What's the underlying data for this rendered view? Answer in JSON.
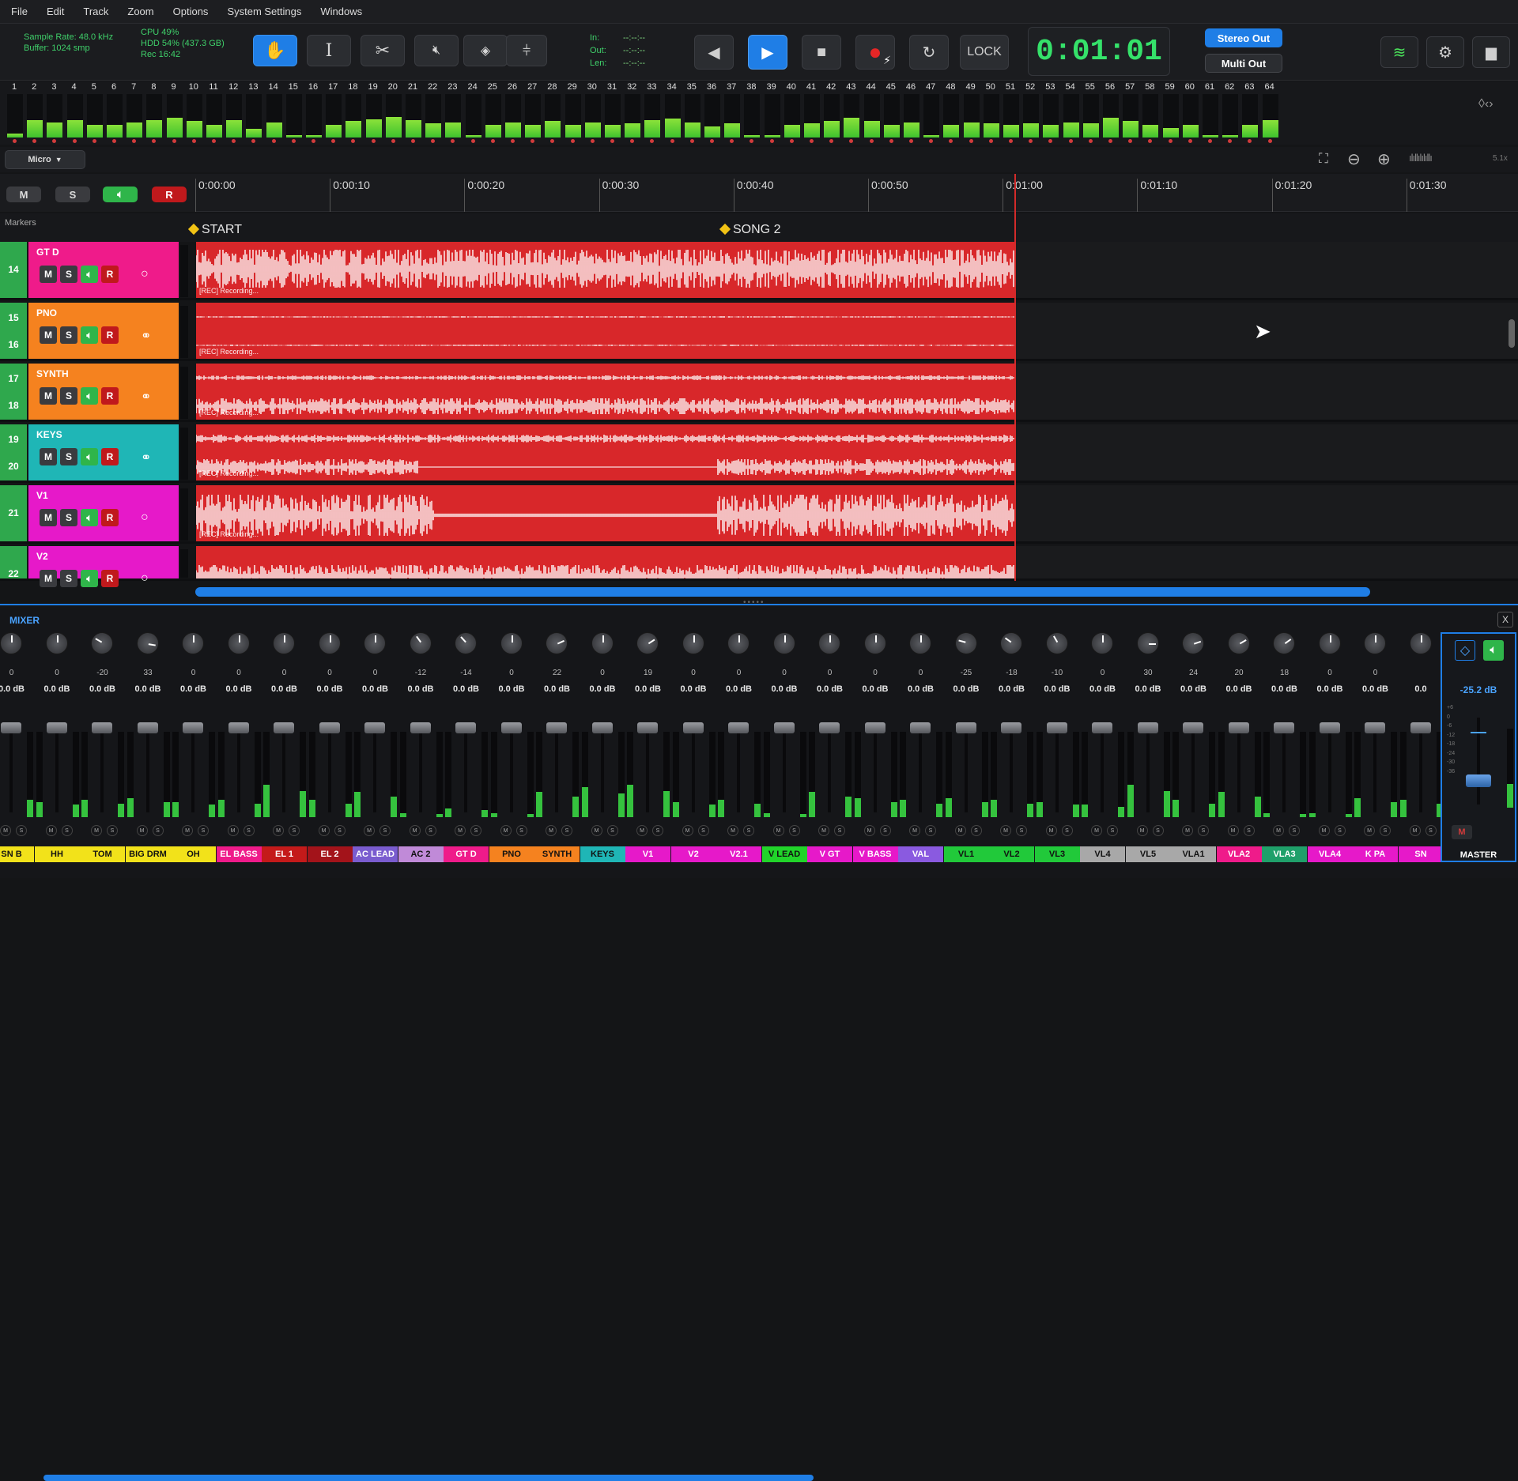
{
  "menu": [
    "File",
    "Edit",
    "Track",
    "Zoom",
    "Options",
    "System Settings",
    "Windows"
  ],
  "status": {
    "sample_rate": "Sample Rate: 48.0 kHz",
    "buffer": "Buffer: 1024 smp",
    "cpu": "CPU 49%",
    "hdd": "HDD 54% (437.3 GB)",
    "rec": "Rec 16:42"
  },
  "io": {
    "in": "In:",
    "out": "Out:",
    "len": "Len:",
    "in_val": "--:--:--",
    "out_val": "--:--:--",
    "len_val": "--:--:--"
  },
  "transport": {
    "lock": "LOCK",
    "timecode": "0:01:01",
    "stereo_out": "Stereo Out",
    "multi_out": "Multi Out"
  },
  "meters": {
    "numbers": [
      "1",
      "2",
      "3",
      "4",
      "5",
      "6",
      "7",
      "8",
      "9",
      "10",
      "11",
      "12",
      "13",
      "14",
      "15",
      "16",
      "17",
      "18",
      "19",
      "20",
      "21",
      "22",
      "23",
      "24",
      "25",
      "26",
      "27",
      "28",
      "29",
      "30",
      "31",
      "32",
      "33",
      "34",
      "35",
      "36",
      "37",
      "38",
      "39",
      "40",
      "41",
      "42",
      "43",
      "44",
      "45",
      "46",
      "47",
      "48",
      "49",
      "50",
      "51",
      "52",
      "53",
      "54",
      "55",
      "56",
      "57",
      "58",
      "59",
      "60",
      "61",
      "62",
      "63",
      "64"
    ],
    "levels": [
      0.1,
      0.4,
      0.35,
      0.4,
      0.3,
      0.3,
      0.35,
      0.4,
      0.45,
      0.38,
      0.3,
      0.4,
      0.2,
      0.35,
      0.05,
      0.05,
      0.3,
      0.38,
      0.42,
      0.48,
      0.4,
      0.32,
      0.35,
      0.05,
      0.3,
      0.35,
      0.3,
      0.38,
      0.3,
      0.35,
      0.3,
      0.32,
      0.4,
      0.44,
      0.35,
      0.25,
      0.32,
      0.05,
      0.05,
      0.3,
      0.32,
      0.38,
      0.45,
      0.38,
      0.3,
      0.35,
      0.05,
      0.3,
      0.35,
      0.33,
      0.3,
      0.32,
      0.3,
      0.35,
      0.33,
      0.45,
      0.38,
      0.3,
      0.22,
      0.3,
      0.05,
      0.05,
      0.3,
      0.4
    ]
  },
  "zoom": {
    "mode": "Micro",
    "scale": "5.1x"
  },
  "msr": {
    "m": "M",
    "s": "S",
    "r": "R"
  },
  "ruler": [
    "0:00:00",
    "0:00:10",
    "0:00:20",
    "0:00:30",
    "0:00:40",
    "0:00:50",
    "0:01:00",
    "0:01:10",
    "0:01:20",
    "0:01:30"
  ],
  "markers": {
    "label": "Markers",
    "items": [
      "START",
      "SONG 2"
    ]
  },
  "tracks": [
    {
      "nums": [
        "14"
      ],
      "name": "GT D",
      "color": "#ef1b8a",
      "rec": "[REC] Recording...",
      "stereo": false
    },
    {
      "nums": [
        "15",
        "16"
      ],
      "name": "PNO",
      "color": "#f5821f",
      "rec": "[REC] Recording...",
      "stereo": true
    },
    {
      "nums": [
        "17",
        "18"
      ],
      "name": "SYNTH",
      "color": "#f5821f",
      "rec": "[REC] Recording...",
      "stereo": true
    },
    {
      "nums": [
        "19",
        "20"
      ],
      "name": "KEYS",
      "color": "#1fb6b6",
      "rec": "[REC] Recording...",
      "stereo": true
    },
    {
      "nums": [
        "21"
      ],
      "name": "V1",
      "color": "#e619c9",
      "rec": "[REC] Recording...",
      "stereo": false
    },
    {
      "nums": [
        "22"
      ],
      "name": "V2",
      "color": "#e619c9",
      "rec": "",
      "stereo": false
    }
  ],
  "mixer": {
    "title": "MIXER",
    "close": "X",
    "strips": [
      {
        "name": "SN B",
        "pan": "0",
        "gain": "0.0 dB",
        "color": "#f2e21a",
        "text": "#111",
        "meter": 0.25
      },
      {
        "name": "HH",
        "pan": "0",
        "gain": "0.0 dB",
        "color": "#f2e21a",
        "text": "#111",
        "meter": 0.18
      },
      {
        "name": "TOM",
        "pan": "-20",
        "gain": "0.0 dB",
        "color": "#f2e21a",
        "text": "#111",
        "meter": 0.2
      },
      {
        "name": "BIG DRM",
        "pan": "33",
        "gain": "0.0 dB",
        "color": "#f2e21a",
        "text": "#111",
        "meter": 0.22
      },
      {
        "name": "OH",
        "pan": "0",
        "gain": "0.0 dB",
        "color": "#f2e21a",
        "text": "#111",
        "meter": 0.18
      },
      {
        "name": "EL BASS",
        "pan": "0",
        "gain": "0.0 dB",
        "color": "#ef1b8a",
        "text": "#fff",
        "meter": 0.2
      },
      {
        "name": "EL 1",
        "pan": "0",
        "gain": "0.0 dB",
        "color": "#c41a1a",
        "text": "#fff",
        "meter": 0.38
      },
      {
        "name": "EL 2",
        "pan": "0",
        "gain": "0.0 dB",
        "color": "#a3131a",
        "text": "#fff",
        "meter": 0.2
      },
      {
        "name": "AC LEAD",
        "pan": "0",
        "gain": "0.0 dB",
        "color": "#7a5ccf",
        "text": "#fff",
        "meter": 0.3
      },
      {
        "name": "AC 2",
        "pan": "-12",
        "gain": "0.0 dB",
        "color": "#c08ad8",
        "text": "#111",
        "meter": 0.05
      },
      {
        "name": "GT D",
        "pan": "-14",
        "gain": "0.0 dB",
        "color": "#ef1b8a",
        "text": "#fff",
        "meter": 0.1
      },
      {
        "name": "PNO",
        "pan": "0",
        "gain": "0.0 dB",
        "color": "#f5821f",
        "text": "#111",
        "meter": 0.05
      },
      {
        "name": "SYNTH",
        "pan": "22",
        "gain": "0.0 dB",
        "color": "#f5821f",
        "text": "#111",
        "meter": 0.3
      },
      {
        "name": "KEYS",
        "pan": "0",
        "gain": "0.0 dB",
        "color": "#1fb6b6",
        "text": "#111",
        "meter": 0.35
      },
      {
        "name": "V1",
        "pan": "19",
        "gain": "0.0 dB",
        "color": "#e619c9",
        "text": "#fff",
        "meter": 0.38
      },
      {
        "name": "V2",
        "pan": "0",
        "gain": "0.0 dB",
        "color": "#e619c9",
        "text": "#fff",
        "meter": 0.18
      },
      {
        "name": "V2.1",
        "pan": "0",
        "gain": "0.0 dB",
        "color": "#e619c9",
        "text": "#fff",
        "meter": 0.2
      },
      {
        "name": "V LEAD",
        "pan": "0",
        "gain": "0.0 dB",
        "color": "#21d42a",
        "text": "#111",
        "meter": 0.05
      },
      {
        "name": "V GT",
        "pan": "0",
        "gain": "0.0 dB",
        "color": "#e619c9",
        "text": "#fff",
        "meter": 0.3
      },
      {
        "name": "V BASS",
        "pan": "0",
        "gain": "0.0 dB",
        "color": "#e619c9",
        "text": "#fff",
        "meter": 0.22
      },
      {
        "name": "VAL",
        "pan": "0",
        "gain": "0.0 dB",
        "color": "#8a5ae0",
        "text": "#fff",
        "meter": 0.2
      },
      {
        "name": "VL1",
        "pan": "-25",
        "gain": "0.0 dB",
        "color": "#21c93a",
        "text": "#111",
        "meter": 0.22
      },
      {
        "name": "VL2",
        "pan": "-18",
        "gain": "0.0 dB",
        "color": "#21c93a",
        "text": "#111",
        "meter": 0.2
      },
      {
        "name": "VL3",
        "pan": "-10",
        "gain": "0.0 dB",
        "color": "#21c93a",
        "text": "#111",
        "meter": 0.18
      },
      {
        "name": "VL4",
        "pan": "0",
        "gain": "0.0 dB",
        "color": "#a8a8a8",
        "text": "#111",
        "meter": 0.15
      },
      {
        "name": "VL5",
        "pan": "30",
        "gain": "0.0 dB",
        "color": "#a8a8a8",
        "text": "#111",
        "meter": 0.38
      },
      {
        "name": "VLA1",
        "pan": "24",
        "gain": "0.0 dB",
        "color": "#a8a8a8",
        "text": "#111",
        "meter": 0.2
      },
      {
        "name": "VLA2",
        "pan": "20",
        "gain": "0.0 dB",
        "color": "#ef1b8a",
        "text": "#fff",
        "meter": 0.3
      },
      {
        "name": "VLA3",
        "pan": "18",
        "gain": "0.0 dB",
        "color": "#1fa06a",
        "text": "#fff",
        "meter": 0.05
      },
      {
        "name": "VLA4",
        "pan": "0",
        "gain": "0.0 dB",
        "color": "#e619c9",
        "text": "#fff",
        "meter": 0.05
      },
      {
        "name": "K PA",
        "pan": "0",
        "gain": "0.0 dB",
        "color": "#e619c9",
        "text": "#fff",
        "meter": 0.22
      },
      {
        "name": "SN",
        "pan": "",
        "gain": "0.0",
        "color": "#e619c9",
        "text": "#fff",
        "meter": 0.2
      }
    ],
    "master": {
      "name": "MASTER",
      "gain": "-25.2 dB",
      "scale": [
        "+6",
        "0",
        "-6",
        "-12",
        "-18",
        "-24",
        "-30",
        "-36"
      ],
      "mute": "M"
    }
  }
}
